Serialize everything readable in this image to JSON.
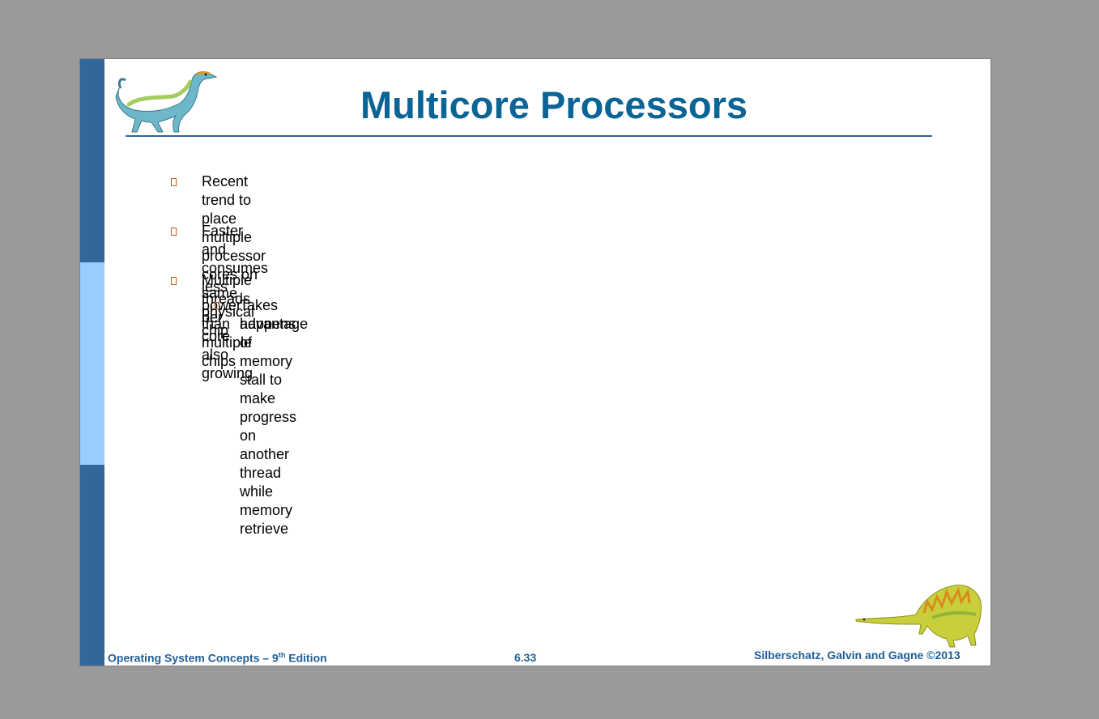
{
  "slide": {
    "title": "Multicore Processors",
    "bullets": [
      {
        "text": "Recent trend to place multiple processor cores on same physical chip"
      },
      {
        "text": "Faster and consumes less power than multiple chips"
      },
      {
        "text": "Multiple threads per core also growing"
      }
    ],
    "sub_bullets": [
      {
        "line1": "Takes advantage of memory stall to make progress on another thread while memory retrieve",
        "line2": "happens"
      }
    ],
    "footer": {
      "left_prefix": "Operating System Concepts – 9",
      "left_sup": "th",
      "left_suffix": " Edition",
      "center": "6.33",
      "right": "Silberschatz, Galvin and Gagne ©2013"
    }
  },
  "colors": {
    "title": "#0a6496",
    "sidebar_dark": "#336699",
    "sidebar_light": "#99ccff",
    "rule": "#336699",
    "footer": "#1f5f97",
    "bullet": "#c05a1c"
  }
}
